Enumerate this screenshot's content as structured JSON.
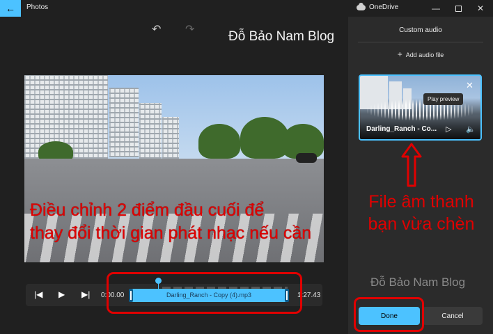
{
  "titlebar": {
    "app_title": "Photos",
    "onedrive_label": "OneDrive",
    "back_icon": "arrow-left-icon",
    "minimize_icon": "minimize-icon",
    "maximize_icon": "maximize-icon",
    "close_icon": "close-icon"
  },
  "editor": {
    "watermark": "Đỗ Bảo Nam Blog",
    "undo_glyph": "↶",
    "redo_glyph": "↷",
    "video_caption_line1": "Điều chỉnh 2 điểm đầu  cuối để",
    "video_caption_line2": "thay đổi thời gian phát nhạc nếu cần"
  },
  "timeline": {
    "time_start": "0:00.00",
    "time_end": "1:27.43",
    "clip_label": "Darling_Ranch - Copy (4).mp3"
  },
  "panel": {
    "title": "Custom audio",
    "add_audio_label": "Add audio file",
    "card_name": "Darling_Ranch - Co...",
    "tooltip": "Play preview",
    "note_line1": "File âm thanh",
    "note_line2": "bạn vừa chèn",
    "watermark": "Đỗ Bảo Nam Blog",
    "done_label": "Done",
    "cancel_label": "Cancel"
  },
  "colors": {
    "accent": "#4cc2ff",
    "annotation_red": "#e00000",
    "background": "#202020",
    "panel": "#2b2b2b"
  }
}
